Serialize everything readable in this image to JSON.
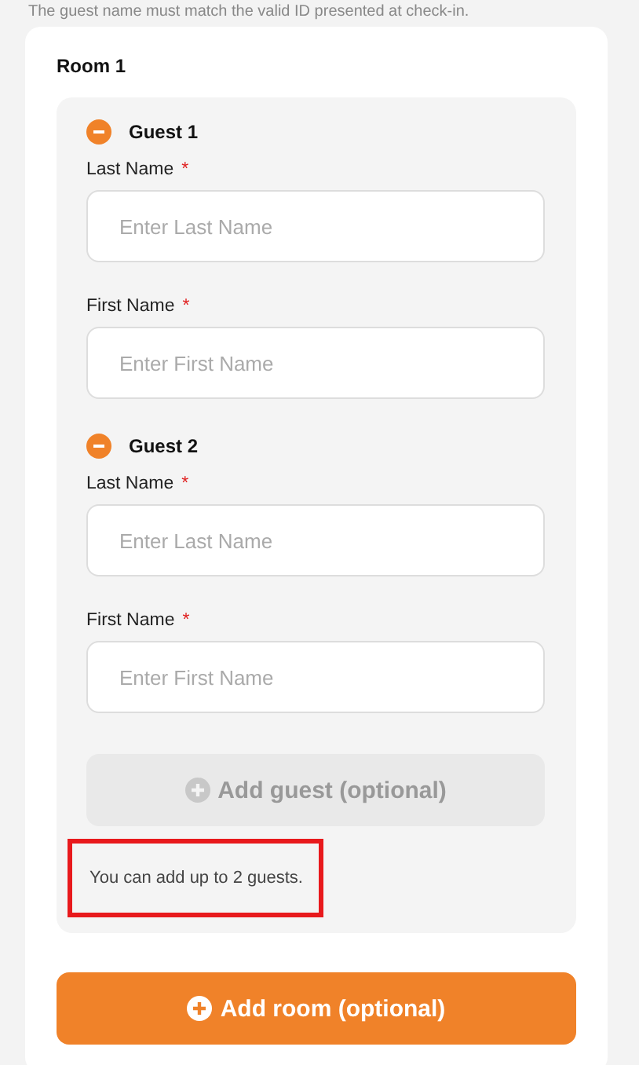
{
  "intro": "The guest name must match the valid ID presented at check-in.",
  "room": {
    "title": "Room 1",
    "guests": [
      {
        "title": "Guest 1",
        "fields": [
          {
            "label": "Last Name",
            "required_mark": "*",
            "placeholder": "Enter Last Name"
          },
          {
            "label": "First Name",
            "required_mark": "*",
            "placeholder": "Enter First Name"
          }
        ]
      },
      {
        "title": "Guest 2",
        "fields": [
          {
            "label": "Last Name",
            "required_mark": "*",
            "placeholder": "Enter Last Name"
          },
          {
            "label": "First Name",
            "required_mark": "*",
            "placeholder": "Enter First Name"
          }
        ]
      }
    ],
    "add_guest": {
      "label": "Add guest (optional)",
      "disabled": true
    },
    "note": {
      "text": "You can add up to 2 guests.",
      "highlighted": true
    }
  },
  "add_room": {
    "label": "Add room (optional)"
  }
}
